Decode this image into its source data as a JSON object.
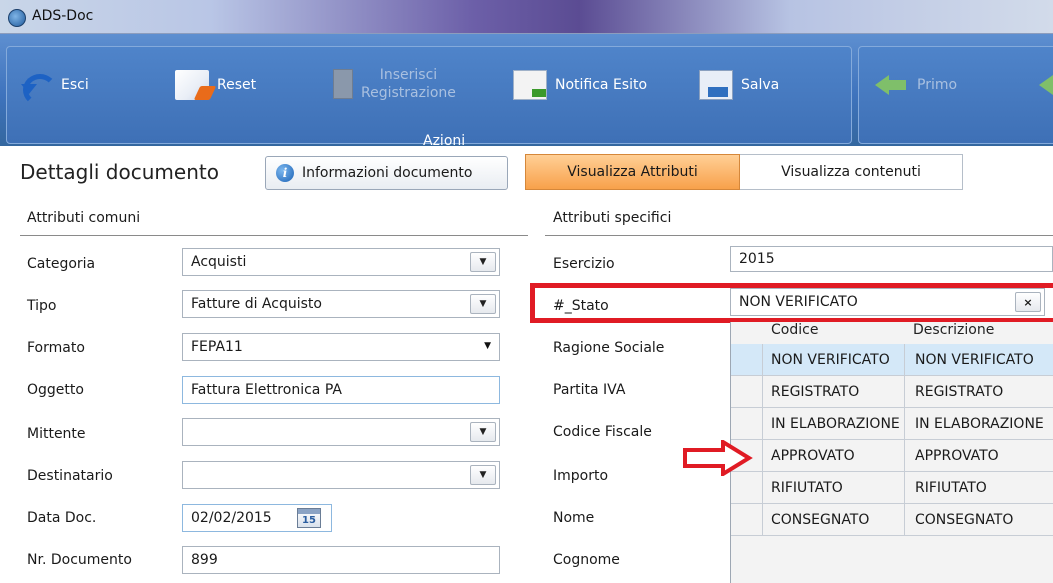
{
  "window": {
    "title": "ADS-Doc"
  },
  "ribbon": {
    "buttons": [
      {
        "label": "Esci",
        "icon": "exit-icon",
        "enabled": true
      },
      {
        "label": "Reset",
        "icon": "reset-icon",
        "enabled": true
      },
      {
        "label_line1": "Inserisci",
        "label_line2": "Registrazione",
        "icon": "insert-record-icon",
        "enabled": false
      },
      {
        "label": "Notifica Esito",
        "icon": "notify-outcome-icon",
        "enabled": true
      },
      {
        "label": "Salva",
        "icon": "save-icon",
        "enabled": true
      }
    ],
    "group_label": "Azioni",
    "nav_buttons": [
      {
        "label": "Primo",
        "icon": "arrow-left-icon",
        "enabled": false
      }
    ]
  },
  "details": {
    "title": "Dettagli documento",
    "info_button": "Informazioni documento",
    "tabs": [
      {
        "label": "Visualizza Attributi",
        "active": true
      },
      {
        "label": "Visualizza contenuti",
        "active": false
      }
    ]
  },
  "common": {
    "heading": "Attributi comuni",
    "fields": [
      {
        "label": "Categoria",
        "value": "Acquisti",
        "type": "combo"
      },
      {
        "label": "Tipo",
        "value": "Fatture di Acquisto",
        "type": "combo"
      },
      {
        "label": "Formato",
        "value": "FEPA11",
        "type": "select"
      },
      {
        "label": "Oggetto",
        "value": "Fattura Elettronica PA",
        "type": "text"
      },
      {
        "label": "Mittente",
        "value": "",
        "type": "combo"
      },
      {
        "label": "Destinatario",
        "value": "",
        "type": "combo"
      },
      {
        "label": "Data Doc.",
        "value": "02/02/2015",
        "type": "date",
        "calendar_day": "15"
      },
      {
        "label": "Nr. Documento",
        "value": "899",
        "type": "text"
      }
    ]
  },
  "specific": {
    "heading": "Attributi specifici",
    "fields": [
      {
        "label": "Esercizio",
        "value": "2015"
      },
      {
        "label": "#_Stato",
        "value": "NON VERIFICATO"
      },
      {
        "label": "Ragione Sociale"
      },
      {
        "label": "Partita IVA"
      },
      {
        "label": "Codice Fiscale"
      },
      {
        "label": "Importo"
      },
      {
        "label": "Nome"
      },
      {
        "label": "Cognome"
      }
    ],
    "stato_clear": "×"
  },
  "stato_grid": {
    "columns": [
      "Codice",
      "Descrizione"
    ],
    "rows": [
      [
        "NON VERIFICATO",
        "NON VERIFICATO"
      ],
      [
        "REGISTRATO",
        "REGISTRATO"
      ],
      [
        "IN ELABORAZIONE",
        "IN ELABORAZIONE"
      ],
      [
        "APPROVATO",
        "APPROVATO"
      ],
      [
        "RIFIUTATO",
        "RIFIUTATO"
      ],
      [
        "CONSEGNATO",
        "CONSEGNATO"
      ]
    ],
    "selected_index": 0
  },
  "colors": {
    "highlight_red": "#e01b24",
    "ribbon_blue": "#3e73bd",
    "tab_active_orange": "#f8a14b",
    "grid_selected": "#d4e8f8"
  }
}
